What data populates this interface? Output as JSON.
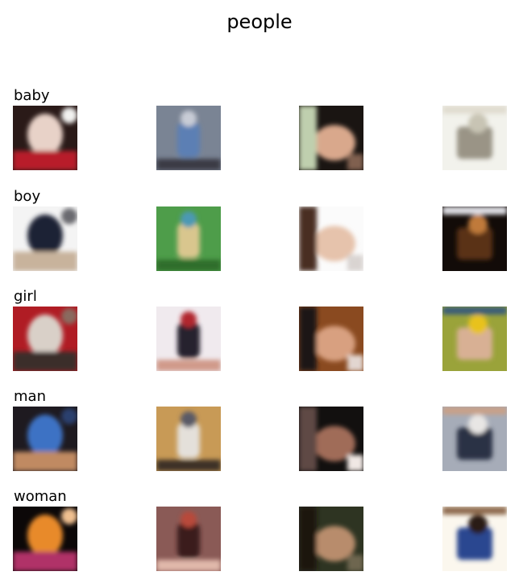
{
  "title": "people",
  "rows": [
    {
      "label": "baby",
      "images": [
        {
          "name": "baby-face-closeup-image",
          "colors": [
            "#2a1a18",
            "#e8d2c8",
            "#b81c2a",
            "#f2f2f0"
          ]
        },
        {
          "name": "baby-sitting-blue-outfit-image",
          "colors": [
            "#7a8494",
            "#c8ccd6",
            "#5b7fb4",
            "#3a3a44"
          ]
        },
        {
          "name": "baby-sleeping-image",
          "colors": [
            "#1a1512",
            "#d9a88c",
            "#bfcfae",
            "#806050"
          ]
        },
        {
          "name": "baby-sepia-drawing-image",
          "colors": [
            "#f2f2ec",
            "#c8c4b4",
            "#9a9486",
            "#e0dccf"
          ]
        }
      ]
    },
    {
      "label": "boy",
      "images": [
        {
          "name": "boy-running-image",
          "colors": [
            "#f4f4f4",
            "#1d2134",
            "#c8b39c",
            "#6b6b70"
          ]
        },
        {
          "name": "boy-blue-shirt-green-background-image",
          "colors": [
            "#4e9d4a",
            "#4c99b4",
            "#d9c68e",
            "#2e6d2c"
          ]
        },
        {
          "name": "boy-infant-cake-image",
          "colors": [
            "#fbfbfb",
            "#e6c3ac",
            "#4a2e24",
            "#d9d4d1"
          ]
        },
        {
          "name": "boy-reading-dark-image",
          "colors": [
            "#120b08",
            "#c07a3a",
            "#5a3014",
            "#e2e2e8"
          ]
        }
      ]
    },
    {
      "label": "girl",
      "images": [
        {
          "name": "girl-smiling-red-background-image",
          "colors": [
            "#b01c24",
            "#d9d0c8",
            "#3a2e2a",
            "#8a6a5e"
          ]
        },
        {
          "name": "girl-sitting-red-image",
          "colors": [
            "#f0eaee",
            "#b1262e",
            "#25232e",
            "#d09a8a"
          ]
        },
        {
          "name": "girl-dark-hair-image",
          "colors": [
            "#8a4a20",
            "#d8a080",
            "#1e1416",
            "#e2d6d0"
          ]
        },
        {
          "name": "girl-yellow-green-image",
          "colors": [
            "#9aa33a",
            "#e8c21e",
            "#d8b094",
            "#3b5d78"
          ]
        }
      ]
    },
    {
      "label": "man",
      "images": [
        {
          "name": "man-blue-shirt-image",
          "colors": [
            "#1e1a20",
            "#3d72c4",
            "#c08a62",
            "#2b3f6e"
          ]
        },
        {
          "name": "man-standing-room-image",
          "colors": [
            "#c89a56",
            "#5a5a66",
            "#e4e0da",
            "#3e3028"
          ]
        },
        {
          "name": "man-dark-portrait-image",
          "colors": [
            "#12100f",
            "#a06c58",
            "#5e4a44",
            "#f0e8e4"
          ]
        },
        {
          "name": "man-holding-fish-image",
          "colors": [
            "#a6acb8",
            "#e8e6e4",
            "#2c3244",
            "#c8a088"
          ]
        }
      ]
    },
    {
      "label": "woman",
      "images": [
        {
          "name": "woman-orange-costume-image",
          "colors": [
            "#0c0808",
            "#e88a2a",
            "#b03268",
            "#f0c090"
          ]
        },
        {
          "name": "woman-red-hair-image",
          "colors": [
            "#8a5a56",
            "#b84a3a",
            "#3a1a1c",
            "#e0b8aa"
          ]
        },
        {
          "name": "woman-dark-portrait-image",
          "colors": [
            "#2e3422",
            "#b88c6c",
            "#1a1410",
            "#6e6650"
          ]
        },
        {
          "name": "woman-striped-shirt-image",
          "colors": [
            "#fbf7ee",
            "#2a1a16",
            "#2a4690",
            "#8e6a4e"
          ]
        }
      ]
    }
  ]
}
